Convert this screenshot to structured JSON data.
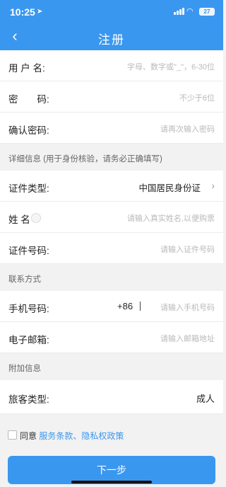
{
  "status": {
    "time": "10:25",
    "battery": "27"
  },
  "nav": {
    "title": "注册"
  },
  "form": {
    "username_label": "用 户 名:",
    "username_placeholder": "字母、数字或\"_\"，6-30位",
    "password_label": "密　　码:",
    "password_placeholder": "不少于6位",
    "confirm_label": "确认密码:",
    "confirm_placeholder": "请再次输入密码"
  },
  "detail": {
    "section_title": "详细信息 (用于身份核验，请务必正确填写)",
    "id_type_label": "证件类型:",
    "id_type_value": "中国居民身份证",
    "name_label": "姓 名",
    "name_placeholder": "请输入真实姓名,以便购票",
    "id_number_label": "证件号码:",
    "id_number_placeholder": "请输入证件号码"
  },
  "contact": {
    "section_title": "联系方式",
    "phone_label": "手机号码:",
    "phone_prefix": "+86",
    "phone_placeholder": "请输入手机号码",
    "email_label": "电子邮箱:",
    "email_placeholder": "请输入邮箱地址"
  },
  "extra": {
    "section_title": "附加信息",
    "passenger_type_label": "旅客类型:",
    "passenger_type_value": "成人"
  },
  "agreement": {
    "prefix": "同意",
    "terms_link": "服务条款",
    "separator": "、",
    "privacy_link": "隐私权政策"
  },
  "actions": {
    "next_label": "下一步"
  },
  "colors": {
    "accent": "#3a97f0",
    "background": "#f2f2f2"
  }
}
